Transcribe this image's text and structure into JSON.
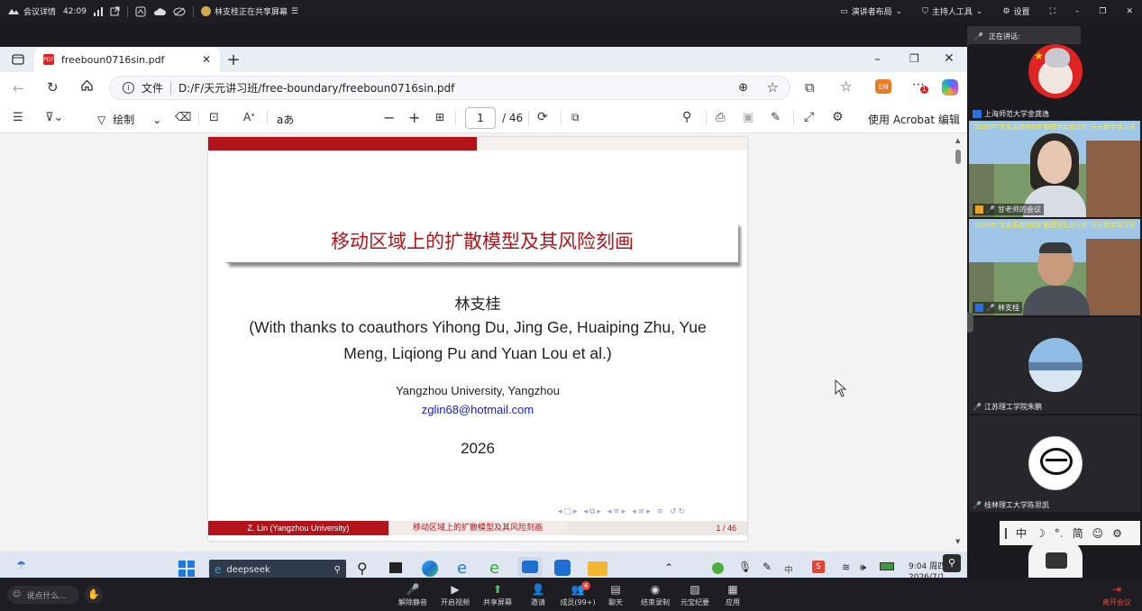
{
  "topbar": {
    "meeting_details": "会议详情",
    "time": "42:09",
    "sharing_status": "林支桂正在共享屏幕",
    "presenter_layout": "演讲者布局",
    "host_tools": "主持人工具",
    "settings": "设置"
  },
  "speaking": {
    "label": "正在讲话:"
  },
  "browser": {
    "tab_title": "freeboun0716sin.pdf",
    "address_label": "文件",
    "address": "D:/F/天元讲习班/free-boundary/freeboun0716sin.pdf"
  },
  "pdf_toolbar": {
    "draw_label": "绘制",
    "text_glyph": "aあ",
    "page_current": "1",
    "page_total": "/ 46",
    "acrobat_label": "使用 Acrobat 编辑"
  },
  "slide": {
    "title": "移动区域上的扩散模型及其风险刻画",
    "author": "林支桂",
    "thanks_line1": "(With thanks to coauthors Yihong Du, Jing Ge, Huaiping Zhu, Yue",
    "thanks_line2": "Meng, Liqiong Pu and Yuan Lou et al.)",
    "affiliation": "Yangzhou University, Yangzhou",
    "email": "zglin68@hotmail.com",
    "year": "2026",
    "footer_left": "Z. Lin (Yangzhou University)",
    "footer_mid": "移动区域上的扩散模型及其风险刻画",
    "footer_right": "1 / 46"
  },
  "taskbar": {
    "search_text": "deepseek",
    "clock_time": "9:04 周四",
    "clock_date": "2026/7/10"
  },
  "participants": [
    {
      "name": "上海师范大学金龚逸"
    },
    {
      "name": "甘老师的会议",
      "banner": "2026年“生态系统中的扩散模型及其分析”天元数学讲习班"
    },
    {
      "name": "林支桂",
      "banner": "2026年“生态系统中的扩散模型及其分析”天元数学讲习班"
    },
    {
      "name": "江苏理工学院朱鹏"
    },
    {
      "name": "桂林理工大学陈思凯"
    }
  ],
  "ime": {
    "lang": "中",
    "mode": "简"
  },
  "meeting_bar": {
    "input_placeholder": "说点什么...",
    "items": [
      "解除静音",
      "开启视频",
      "共享屏幕",
      "邀请",
      "成员(99+)",
      "聊天",
      "结束录制",
      "元宝纪要",
      "应用"
    ],
    "members_badge": "4",
    "leave": "离开会议"
  },
  "colors": {
    "accent_red": "#b3141a",
    "link_blue": "#1a1ad6",
    "leave_red": "#e8453c"
  }
}
